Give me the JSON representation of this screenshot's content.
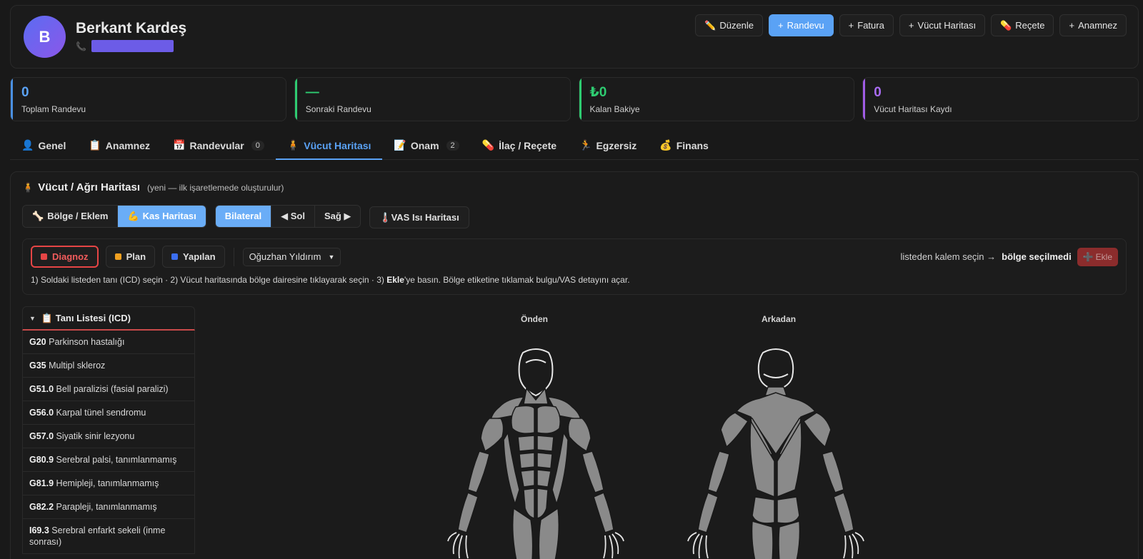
{
  "patient": {
    "initial": "B",
    "name": "Berkant Kardeş",
    "phone_icon": "phone-icon"
  },
  "header_actions": [
    {
      "icon": "✏️",
      "label": "Düzenle"
    },
    {
      "icon": "+",
      "label": "Randevu"
    },
    {
      "icon": "+",
      "label": "Fatura"
    },
    {
      "icon": "+",
      "label": "Vücut Haritası"
    },
    {
      "icon": "💊",
      "label": "Reçete"
    },
    {
      "icon": "+",
      "label": "Anamnez"
    }
  ],
  "stats": [
    {
      "value": "0",
      "label": "Toplam Randevu",
      "color": "#5aa2f5"
    },
    {
      "value": "—",
      "label": "Sonraki Randevu",
      "color": "#2ecc71"
    },
    {
      "value": "₺0",
      "label": "Kalan Bakiye",
      "color": "#2ecc71"
    },
    {
      "value": "0",
      "label": "Vücut Haritası Kaydı",
      "color": "#a86bf0"
    }
  ],
  "tabs": [
    {
      "icon": "👤",
      "label": "Genel",
      "count": ""
    },
    {
      "icon": "📋",
      "label": "Anamnez",
      "count": ""
    },
    {
      "icon": "📅",
      "label": "Randevular",
      "count": "0"
    },
    {
      "icon": "🧍",
      "label": "Vücut Haritası",
      "count": ""
    },
    {
      "icon": "📝",
      "label": "Onam",
      "count": "2"
    },
    {
      "icon": "💊",
      "label": "İlaç / Reçete",
      "count": ""
    },
    {
      "icon": "🏃",
      "label": "Egzersiz",
      "count": ""
    },
    {
      "icon": "💰",
      "label": "Finans",
      "count": ""
    }
  ],
  "panel": {
    "icon": "🧍",
    "title": "Vücut / Ağrı Haritası",
    "subtitle": "(yeni — ilk işaretlemede oluşturulur)",
    "mode_buttons": [
      {
        "icon": "🦴",
        "label": "Bölge / Eklem"
      },
      {
        "icon": "💪",
        "label": "Kas Haritası"
      }
    ],
    "side_buttons": [
      "Bilateral",
      "◀ Sol",
      "Sağ ▶"
    ],
    "vas_label": "🌡️VAS Isı Haritası",
    "mark_types": [
      {
        "label": "Diagnoz",
        "color": "#e64545"
      },
      {
        "label": "Plan",
        "color": "#f0a020"
      },
      {
        "label": "Yapılan",
        "color": "#3b6ef0"
      }
    ],
    "therapist": "Oğuzhan Yıldırım",
    "status_prefix": "listeden kalem seçin →",
    "status_bold": "bölge seçilmedi",
    "add_label": "Ekle",
    "help_part1": "1) Soldaki listeden tanı (ICD) seçin · 2) Vücut haritasında bölge dairesine tıklayarak seçin · 3)",
    "help_bold": "Ekle",
    "help_part2": "'ye basın. Bölge etiketine tıklamak bulgu/VAS detayını açar."
  },
  "icd_list": {
    "title": "📋 Tanı Listesi (ICD)",
    "items": [
      {
        "code": "G20",
        "name": "Parkinson hastalığı"
      },
      {
        "code": "G35",
        "name": "Multipl skleroz"
      },
      {
        "code": "G51.0",
        "name": "Bell paralizisi (fasial paralizi)"
      },
      {
        "code": "G56.0",
        "name": "Karpal tünel sendromu"
      },
      {
        "code": "G57.0",
        "name": "Siyatik sinir lezyonu"
      },
      {
        "code": "G80.9",
        "name": "Serebral palsi, tanımlanmamış"
      },
      {
        "code": "G81.9",
        "name": "Hemipleji, tanımlanmamış"
      },
      {
        "code": "G82.2",
        "name": "Parapleji, tanımlanmamış"
      },
      {
        "code": "I69.3",
        "name": "Serebral enfarkt sekeli (inme sonrası)"
      }
    ]
  },
  "body_map": {
    "front_label": "Önden",
    "back_label": "Arkadan",
    "muscle_color": "#8a8a8a"
  }
}
